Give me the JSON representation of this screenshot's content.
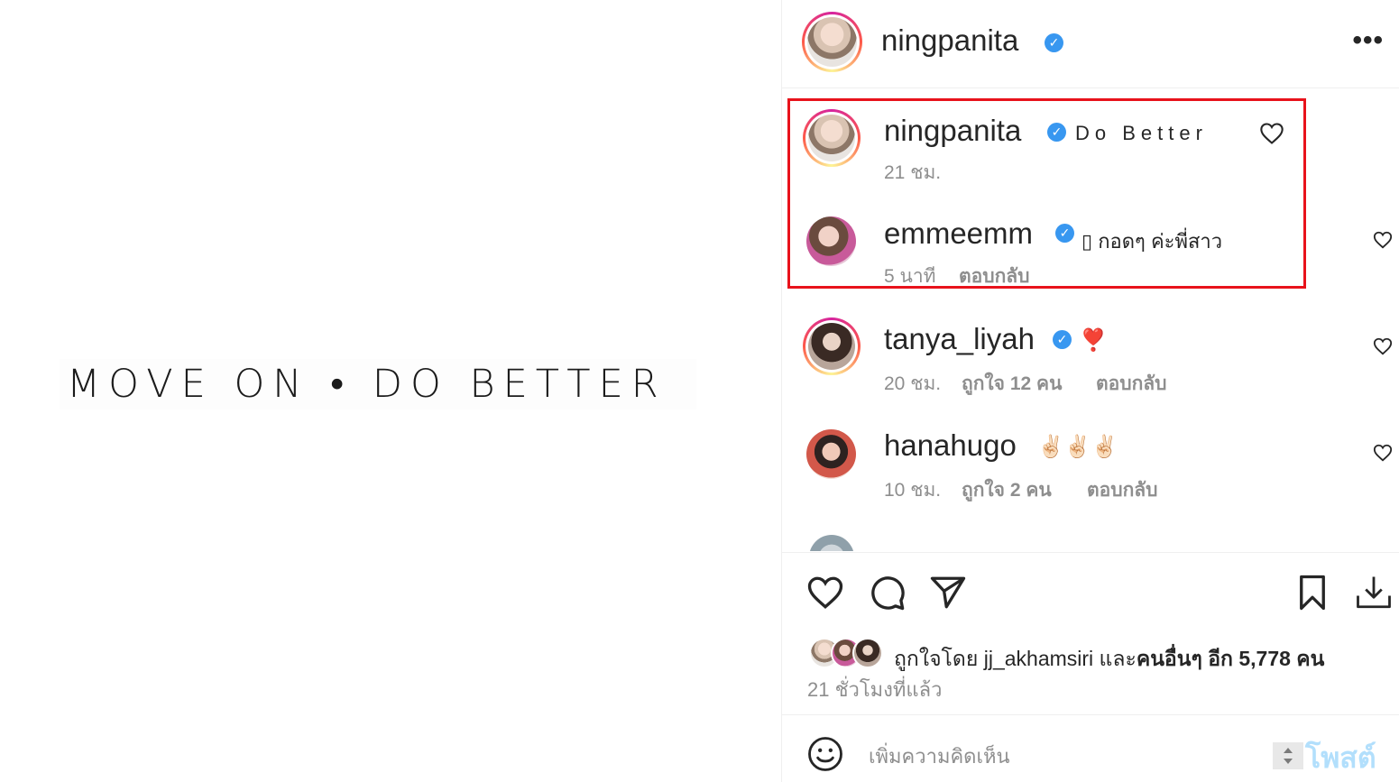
{
  "post": {
    "image_text": "MOVE ON • DO BETTER"
  },
  "header": {
    "username": "ningpanita",
    "more_label": "•••"
  },
  "comments": [
    {
      "username": "ningpanita",
      "text": "Do Better",
      "time": "21 ชม.",
      "likes": "",
      "reply": "",
      "highlighted": true
    },
    {
      "username": "emmeemm",
      "text": "▯ กอดๆ ค่ะพี่สาว",
      "time": "5 นาที",
      "likes": "",
      "reply": "ตอบกลับ",
      "highlighted": true
    },
    {
      "username": "tanya_liyah",
      "text": "❣️",
      "time": "20 ชม.",
      "likes": "ถูกใจ 12 คน",
      "reply": "ตอบกลับ"
    },
    {
      "username": "hanahugo",
      "text": "✌🏻✌🏻✌🏻",
      "time": "10 ชม.",
      "likes": "ถูกใจ 2 คน",
      "reply": "ตอบกลับ"
    }
  ],
  "likes": {
    "prefix": "ถูกใจโดย",
    "user": "jj_akhamsiri",
    "joiner": "และ",
    "others": "คนอื่นๆ อีก 5,778 คน"
  },
  "time_ago": "21 ชั่วโมงที่แล้ว",
  "add_comment": {
    "placeholder": "เพิ่มความคิดเห็น",
    "post_label": "โพสต์"
  },
  "colors": {
    "verified": "#3897f0",
    "highlight_border": "#e8121b",
    "post_button": "#b2dffc",
    "secondary_text": "#8e8e8e"
  },
  "icons": [
    "heart-icon",
    "comment-icon",
    "share-icon",
    "bookmark-icon",
    "download-icon",
    "emoji-icon",
    "more-icon",
    "verified-icon"
  ]
}
